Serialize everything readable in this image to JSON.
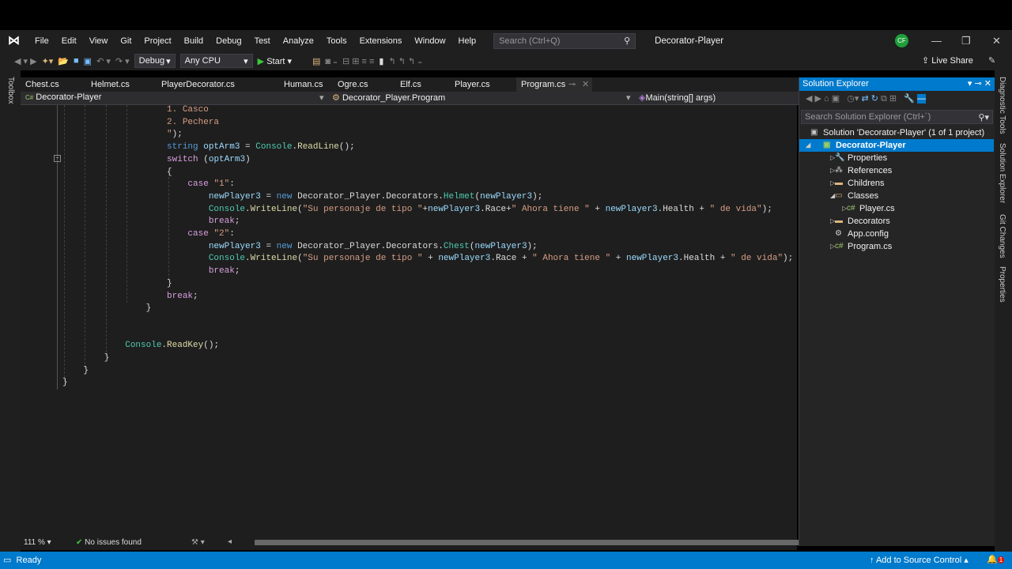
{
  "menu": {
    "items": [
      "File",
      "Edit",
      "View",
      "Git",
      "Project",
      "Build",
      "Debug",
      "Test",
      "Analyze",
      "Tools",
      "Extensions",
      "Window",
      "Help"
    ],
    "search_placeholder": "Search (Ctrl+Q)",
    "window_title": "Decorator-Player",
    "avatar": "CF"
  },
  "toolbar": {
    "config": "Debug",
    "platform": "Any CPU",
    "start": "Start",
    "live_share": "Live Share"
  },
  "toolbox": "Toolbox",
  "tabs": [
    "Chest.cs",
    "Helmet.cs",
    "PlayerDecorator.cs",
    "Human.cs",
    "Ogre.cs",
    "Elf.cs",
    "Player.cs",
    "Program.cs"
  ],
  "navbar": {
    "project": "Decorator-Player",
    "class": "Decorator_Player.Program",
    "member": "Main(string[] args)"
  },
  "code": [
    [
      [
        "str",
        "                    1. Casco"
      ]
    ],
    [
      [
        "str",
        "                    2. Pechera"
      ]
    ],
    [
      [
        "str",
        "                    \""
      ],
      [
        "pl",
        ");"
      ]
    ],
    [
      [
        "kw",
        "                    string "
      ],
      [
        "var",
        "optArm3"
      ],
      [
        "pl",
        " = "
      ],
      [
        "cls",
        "Console"
      ],
      [
        "pl",
        "."
      ],
      [
        "met",
        "ReadLine"
      ],
      [
        "pl",
        "();"
      ]
    ],
    [
      [
        "ctl",
        "                    switch "
      ],
      [
        "pl",
        "("
      ],
      [
        "var",
        "optArm3"
      ],
      [
        "pl",
        ")"
      ]
    ],
    [
      [
        "pl",
        "                    {"
      ]
    ],
    [
      [
        "ctl",
        "                        case "
      ],
      [
        "str",
        "\"1\""
      ],
      [
        "pl",
        ":"
      ]
    ],
    [
      [
        "var",
        "                            newPlayer3"
      ],
      [
        "pl",
        " = "
      ],
      [
        "kw",
        "new "
      ],
      [
        "pl",
        "Decorator_Player.Decorators."
      ],
      [
        "cls",
        "Helmet"
      ],
      [
        "pl",
        "("
      ],
      [
        "var",
        "newPlayer3"
      ],
      [
        "pl",
        ");"
      ]
    ],
    [
      [
        "cls",
        "                            Console"
      ],
      [
        "pl",
        "."
      ],
      [
        "met",
        "WriteLine"
      ],
      [
        "pl",
        "("
      ],
      [
        "str",
        "\"Su personaje de tipo \""
      ],
      [
        "pl",
        "+"
      ],
      [
        "var",
        "newPlayer3"
      ],
      [
        "pl",
        ".Race+"
      ],
      [
        "str",
        "\" Ahora tiene \""
      ],
      [
        "pl",
        " + "
      ],
      [
        "var",
        "newPlayer3"
      ],
      [
        "pl",
        ".Health + "
      ],
      [
        "str",
        "\" de vida\""
      ],
      [
        "pl",
        ");"
      ]
    ],
    [
      [
        "ctl",
        "                            break"
      ],
      [
        "pl",
        ";"
      ]
    ],
    [
      [
        "ctl",
        "                        case "
      ],
      [
        "str",
        "\"2\""
      ],
      [
        "pl",
        ":"
      ]
    ],
    [
      [
        "var",
        "                            newPlayer3"
      ],
      [
        "pl",
        " = "
      ],
      [
        "kw",
        "new "
      ],
      [
        "pl",
        "Decorator_Player.Decorators."
      ],
      [
        "cls",
        "Chest"
      ],
      [
        "pl",
        "("
      ],
      [
        "var",
        "newPlayer3"
      ],
      [
        "pl",
        ");"
      ]
    ],
    [
      [
        "cls",
        "                            Console"
      ],
      [
        "pl",
        "."
      ],
      [
        "met",
        "WriteLine"
      ],
      [
        "pl",
        "("
      ],
      [
        "str",
        "\"Su personaje de tipo \""
      ],
      [
        "pl",
        " + "
      ],
      [
        "var",
        "newPlayer3"
      ],
      [
        "pl",
        ".Race + "
      ],
      [
        "str",
        "\" Ahora tiene \""
      ],
      [
        "pl",
        " + "
      ],
      [
        "var",
        "newPlayer3"
      ],
      [
        "pl",
        ".Health + "
      ],
      [
        "str",
        "\" de vida\""
      ],
      [
        "pl",
        ");"
      ]
    ],
    [
      [
        "ctl",
        "                            break"
      ],
      [
        "pl",
        ";"
      ]
    ],
    [
      [
        "pl",
        "                    }"
      ]
    ],
    [
      [
        "ctl",
        "                    break"
      ],
      [
        "pl",
        ";"
      ]
    ],
    [
      [
        "pl",
        "                }"
      ]
    ],
    [
      [
        "pl",
        ""
      ]
    ],
    [
      [
        "pl",
        ""
      ]
    ],
    [
      [
        "cls",
        "            Console"
      ],
      [
        "pl",
        "."
      ],
      [
        "met",
        "ReadKey"
      ],
      [
        "pl",
        "();"
      ]
    ],
    [
      [
        "pl",
        "        }"
      ]
    ],
    [
      [
        "pl",
        "    }"
      ]
    ],
    [
      [
        "pl",
        "}"
      ]
    ]
  ],
  "editor_status": {
    "zoom": "111 %",
    "issues": "No issues found"
  },
  "solution_explorer": {
    "title": "Solution Explorer",
    "search_placeholder": "Search Solution Explorer (Ctrl+´)",
    "items": [
      {
        "label": "Solution 'Decorator-Player' (1 of 1 project)",
        "icon": "solution-icon",
        "level": 0,
        "arrow": ""
      },
      {
        "label": "Decorator-Player",
        "icon": "csharp-project-icon",
        "level": 0,
        "arrow": "expanded",
        "selected": true
      },
      {
        "label": "Properties",
        "icon": "wrench-icon",
        "level": 1,
        "arrow": "collapsed"
      },
      {
        "label": "References",
        "icon": "references-icon",
        "level": 1,
        "arrow": "collapsed"
      },
      {
        "label": "Childrens",
        "icon": "folder-icon",
        "level": 1,
        "arrow": "collapsed"
      },
      {
        "label": "Classes",
        "icon": "folder-open-icon",
        "level": 1,
        "arrow": "expanded"
      },
      {
        "label": "Player.cs",
        "icon": "csharp-file-icon",
        "level": 2,
        "arrow": "collapsed"
      },
      {
        "label": "Decorators",
        "icon": "folder-icon",
        "level": 1,
        "arrow": "collapsed"
      },
      {
        "label": "App.config",
        "icon": "config-icon",
        "level": 1,
        "arrow": ""
      },
      {
        "label": "Program.cs",
        "icon": "csharp-file-icon",
        "level": 1,
        "arrow": "collapsed"
      }
    ]
  },
  "right_tabs": [
    "Diagnostic Tools",
    "Solution Explorer",
    "Git Changes",
    "Properties"
  ],
  "status": {
    "ready": "Ready",
    "source_control": "Add to Source Control",
    "notifications": "1"
  }
}
